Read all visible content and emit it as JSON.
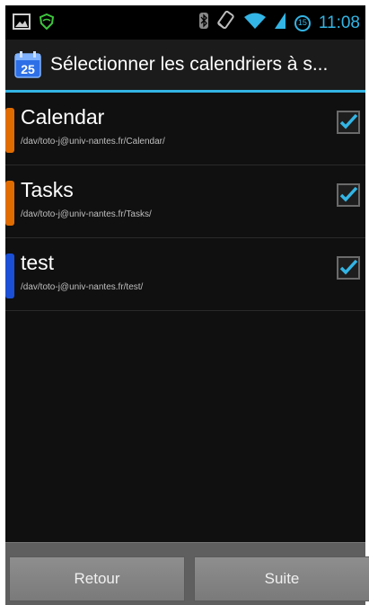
{
  "status_bar": {
    "time": "11:08",
    "icons": [
      "image-icon",
      "shield-icon",
      "bluetooth-icon",
      "rotate-icon",
      "wifi-icon",
      "signal-icon",
      "alarm-icon"
    ],
    "alarm_badge": "15"
  },
  "action_bar": {
    "app_icon_number": "25",
    "title": "Sélectionner les calendriers à s..."
  },
  "calendars": [
    {
      "name": "Calendar",
      "path": "/dav/toto-j@univ-nantes.fr/Calendar/",
      "color": "#e06c00",
      "checked": true
    },
    {
      "name": "Tasks",
      "path": "/dav/toto-j@univ-nantes.fr/Tasks/",
      "color": "#e06c00",
      "checked": true
    },
    {
      "name": "test",
      "path": "/dav/toto-j@univ-nantes.fr/test/",
      "color": "#1a4fd6",
      "checked": true
    }
  ],
  "buttons": {
    "back": "Retour",
    "next": "Suite"
  },
  "colors": {
    "accent": "#33b5e5"
  }
}
